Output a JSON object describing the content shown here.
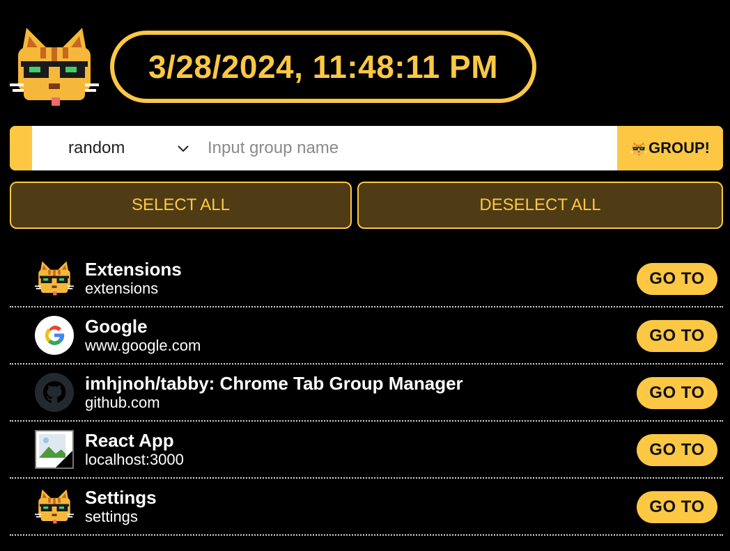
{
  "header": {
    "datetime": "3/28/2024, 11:48:11 PM"
  },
  "group_bar": {
    "selected_color": "random",
    "input_placeholder": "Input group name",
    "input_value": "",
    "group_button_label": "GROUP!"
  },
  "selection": {
    "select_all_label": "SELECT ALL",
    "deselect_all_label": "DESELECT ALL"
  },
  "tabs": [
    {
      "title": "Extensions",
      "url": "extensions",
      "icon": "cat-icon",
      "button": "GO TO"
    },
    {
      "title": "Google",
      "url": "www.google.com",
      "icon": "google-icon",
      "button": "GO TO"
    },
    {
      "title": "imhjnoh/tabby: Chrome Tab Group Manager",
      "url": "github.com",
      "icon": "github-icon",
      "button": "GO TO"
    },
    {
      "title": "React App",
      "url": "localhost:3000",
      "icon": "broken-image-icon",
      "button": "GO TO"
    },
    {
      "title": "Settings",
      "url": "settings",
      "icon": "cat-icon",
      "button": "GO TO"
    }
  ],
  "colors": {
    "accent": "#fcc844",
    "button_dark": "#4f3c14",
    "background": "#000000"
  }
}
